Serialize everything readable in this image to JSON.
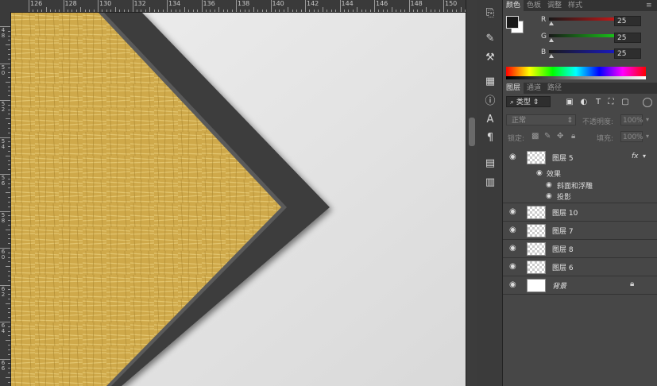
{
  "ruler_top": {
    "labels": [
      "126",
      "128",
      "130",
      "132",
      "134",
      "136",
      "138",
      "140",
      "142",
      "144",
      "146",
      "148",
      "150"
    ]
  },
  "ruler_left": {
    "labels": [
      "4 8",
      "5 0",
      "5 2",
      "5 4",
      "5 6",
      "5 8",
      "6 0",
      "6 2",
      "6 4",
      "6 6"
    ]
  },
  "color_panel": {
    "tabs": [
      "颜色",
      "色板",
      "调整",
      "样式"
    ],
    "channels": [
      {
        "label": "R",
        "value": "25",
        "color": "#e02020"
      },
      {
        "label": "G",
        "value": "25",
        "color": "#20c040"
      },
      {
        "label": "B",
        "value": "25",
        "color": "#2040e0"
      }
    ],
    "foreground": "#191919",
    "background": "#ffffff"
  },
  "layers_panel": {
    "tabs": [
      "图层",
      "通道",
      "路径"
    ],
    "filter_label": "类型",
    "blend_mode": "正常",
    "opacity_label": "不透明度:",
    "opacity_value": "100%",
    "lock_label": "锁定:",
    "fill_label": "填充:",
    "fill_value": "100%",
    "layers": [
      {
        "name": "图层 5",
        "fx": "fx",
        "effects_label": "效果",
        "effects": [
          "斜面和浮雕",
          "投影"
        ]
      },
      {
        "name": "图层 10"
      },
      {
        "name": "图层 7"
      },
      {
        "name": "图层 8"
      },
      {
        "name": "图层 6"
      },
      {
        "name": "背景"
      }
    ]
  },
  "tools": [
    "history-icon",
    "brush-preset-icon",
    "tool-preset-icon",
    "swatch-icon",
    "info-icon",
    "character-icon",
    "paragraph-icon",
    "layer-comps-icon",
    "notes-icon"
  ],
  "colors": {
    "panel_bg": "#474747",
    "frame": "#3d3d3d",
    "canvas_bg": "#e6e6e6",
    "gold": "#d4b050"
  }
}
